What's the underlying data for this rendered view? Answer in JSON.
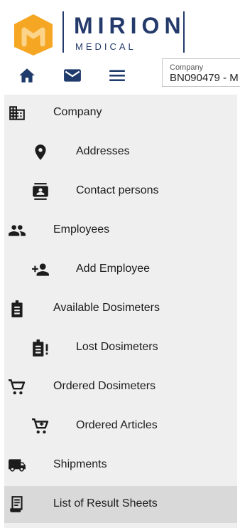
{
  "brand": {
    "name": "MIRION",
    "sub": "MEDICAL",
    "accent": "#f5a623",
    "navy": "#243a6b"
  },
  "toolbar": {
    "home_icon": "home-icon",
    "mail_icon": "mail-icon",
    "menu_icon": "menu-icon"
  },
  "company": {
    "label": "Company",
    "value": "BN090479 - M"
  },
  "nav": [
    {
      "label": "Company",
      "icon": "building-icon"
    },
    {
      "label": "Addresses",
      "icon": "location-pin-icon"
    },
    {
      "label": "Contact persons",
      "icon": "contact-card-icon"
    },
    {
      "label": "Employees",
      "icon": "people-icon"
    },
    {
      "label": "Add Employee",
      "icon": "add-person-icon"
    },
    {
      "label": "Available Dosimeters",
      "icon": "badge-icon"
    },
    {
      "label": "Lost Dosimeters",
      "icon": "badge-alert-icon"
    },
    {
      "label": "Ordered Dosimeters",
      "icon": "cart-icon"
    },
    {
      "label": "Ordered Articles",
      "icon": "cart-plus-icon"
    },
    {
      "label": "Shipments",
      "icon": "truck-icon"
    },
    {
      "label": "List of Result Sheets",
      "icon": "receipt-icon"
    }
  ],
  "active_item": "List of Result Sheets"
}
